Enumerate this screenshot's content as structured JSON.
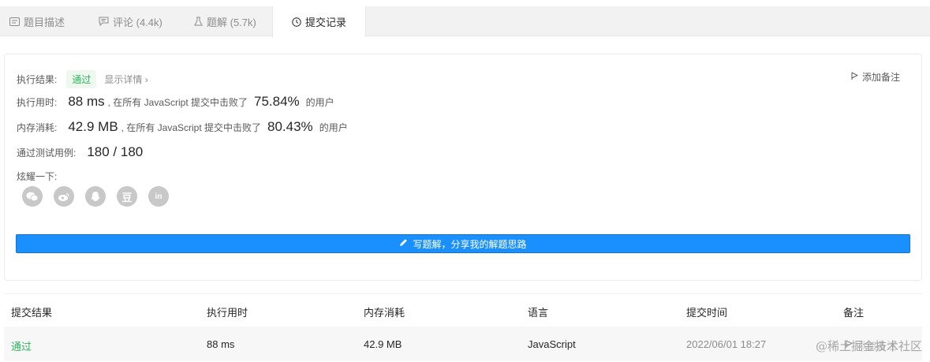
{
  "tabs": [
    {
      "label": "题目描述",
      "icon": "description-icon"
    },
    {
      "label": "评论 (4.4k)",
      "icon": "comment-icon"
    },
    {
      "label": "题解 (5.7k)",
      "icon": "flask-icon"
    },
    {
      "label": "提交记录",
      "icon": "clock-icon",
      "active": true
    }
  ],
  "result": {
    "status_label": "执行结果:",
    "status_value": "通过",
    "detail_link": "显示详情 ›",
    "add_note": "添加备注",
    "runtime_label": "执行用时:",
    "runtime_value": "88 ms",
    "runtime_beat_text": ", 在所有 JavaScript 提交中击败了",
    "runtime_percent": "75.84%",
    "runtime_suffix": "的用户",
    "memory_label": "内存消耗:",
    "memory_value": "42.9 MB",
    "memory_beat_text": ", 在所有 JavaScript 提交中击败了",
    "memory_percent": "80.43%",
    "memory_suffix": "的用户",
    "tests_label": "通过测试用例:",
    "tests_value": "180 / 180",
    "share_label": "炫耀一下:",
    "share_icons": [
      "wechat-icon",
      "weibo-icon",
      "qq-icon",
      "douban-icon",
      "linkedin-icon"
    ],
    "share_glyphs": [
      "",
      "",
      "",
      "豆",
      "in"
    ],
    "write_button": "写题解，分享我的解题思路"
  },
  "table": {
    "headers": [
      "提交结果",
      "执行用时",
      "内存消耗",
      "语言",
      "提交时间",
      "备注"
    ],
    "rows": [
      {
        "status": "通过",
        "runtime": "88 ms",
        "memory": "42.9 MB",
        "language": "JavaScript",
        "time": "2022/06/01 18:27",
        "note": "添加备注"
      }
    ]
  },
  "watermark": "@稀土掘金技术社区",
  "colors": {
    "accent": "#1a90ff",
    "success": "#2db55d",
    "tab_bg": "#f2f2f2"
  }
}
